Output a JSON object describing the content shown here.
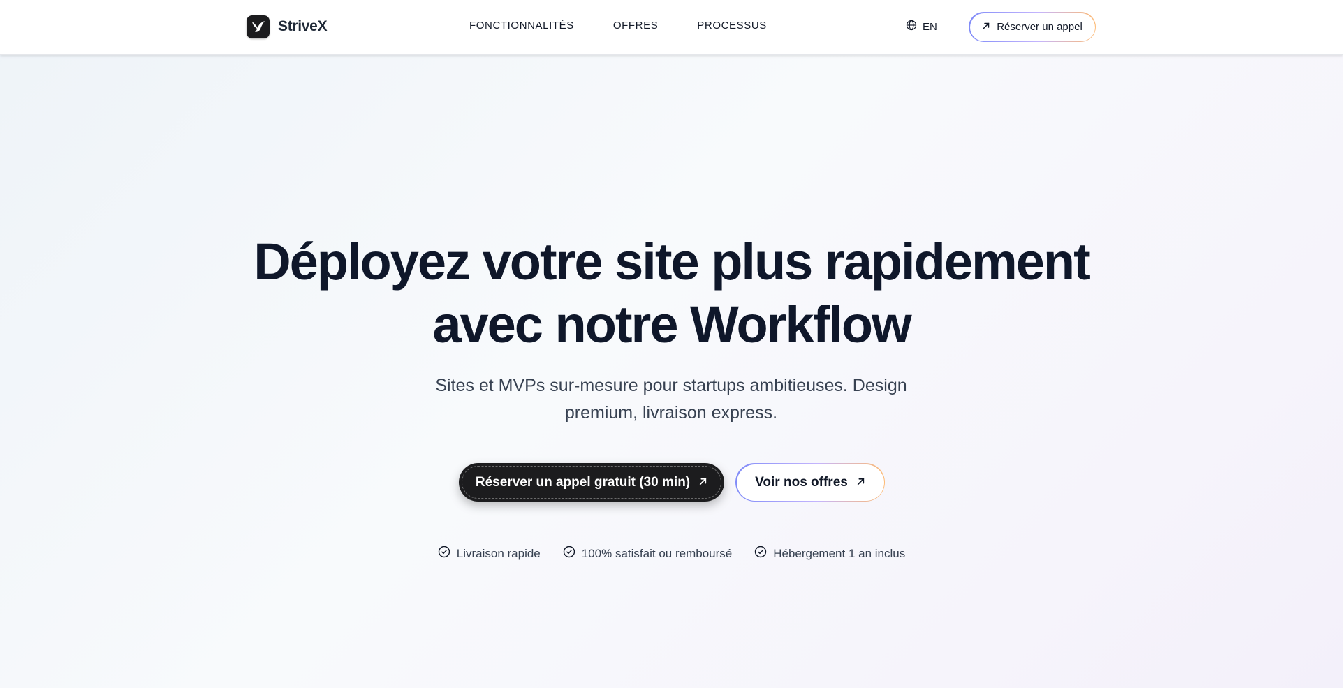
{
  "header": {
    "brand": "StriveX",
    "nav": [
      {
        "label": "FONCTIONNALITÉS"
      },
      {
        "label": "OFFRES"
      },
      {
        "label": "PROCESSUS"
      }
    ],
    "language": "EN",
    "language_icon": "globe-icon",
    "cta_label": "Réserver un appel",
    "cta_icon": "arrow-up-right-icon"
  },
  "hero": {
    "title_line1": "Déployez votre site plus rapidement",
    "title_line2": "avec notre Workflow",
    "subtitle_line1": "Sites et MVPs sur-mesure pour startups ambitieuses. Design",
    "subtitle_line2": "premium, livraison express.",
    "primary_cta": "Réserver un appel gratuit (30 min)",
    "secondary_cta": "Voir nos offres"
  },
  "features": [
    {
      "label": "Livraison rapide",
      "icon": "check-circle-icon"
    },
    {
      "label": "100% satisfait ou remboursé",
      "icon": "check-circle-icon"
    },
    {
      "label": "Hébergement 1 an inclus",
      "icon": "check-circle-icon"
    }
  ],
  "colors": {
    "primary_dark": "#1c1c1e",
    "text": "#0f172a",
    "gradient_start": "#818cf8",
    "gradient_end": "#fdba74"
  }
}
